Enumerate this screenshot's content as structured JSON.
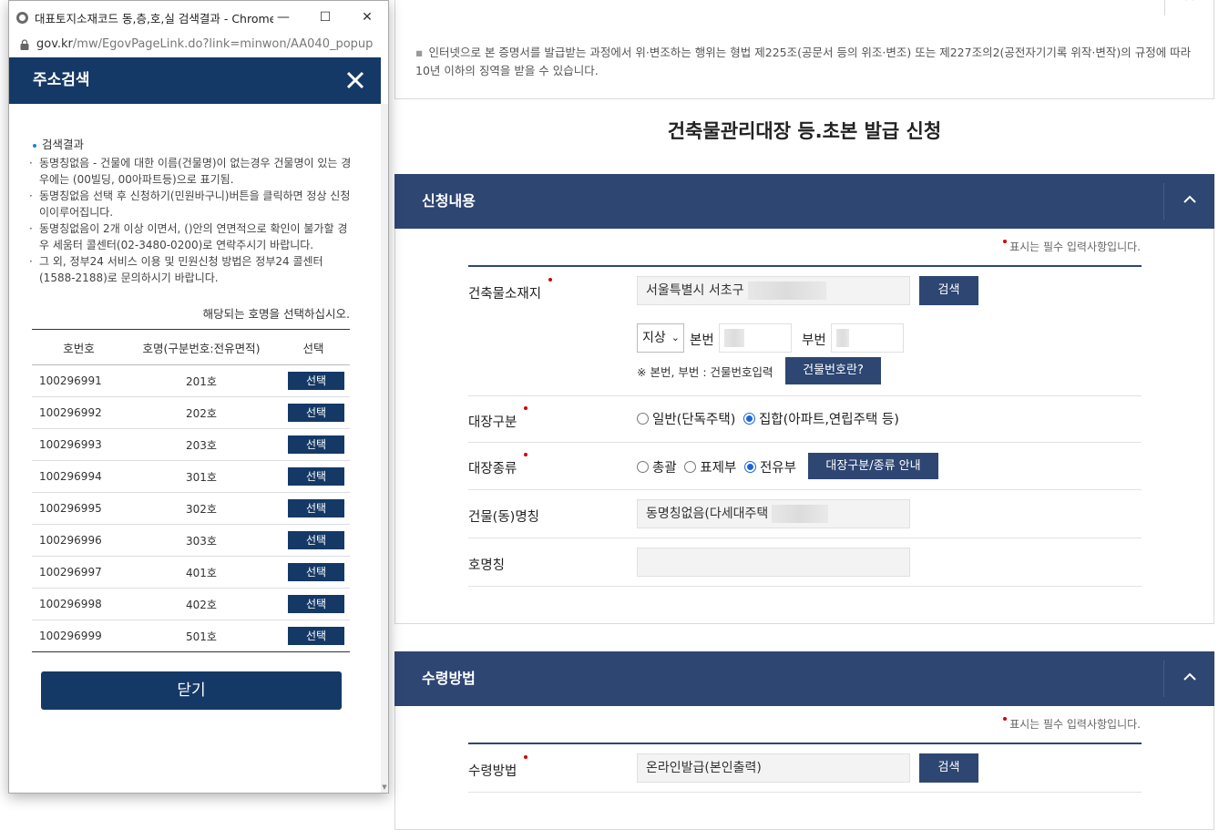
{
  "popup": {
    "window_title": "대표토지소재코드 동,층,호,실 검색결과 - Chrome",
    "url_host": "gov.kr",
    "url_path": "/mw/EgovPageLink.do?link=minwon/AA040_popup",
    "header_title": "주소검색",
    "result_heading": "검색결과",
    "guide": [
      "동명칭없음 - 건물에 대한 이름(건물명)이 없는경우 건물명이 있는 경우에는 (00빌딩, 00아파트등)으로 표기됨.",
      "동명칭없음 선택 후 신청하기(민원바구니)버튼을 클릭하면 정상 신청이이루어집니다.",
      "동명칭없음이 2개 이상 이면서, ()안의 연면적으로 확인이 불가할 경우 세움터 콜센터(02-3480-0200)로 연락주시기 바랍니다.",
      "그 외, 정부24 서비스 이용 및 민원신청 방법은 정부24 콜센터 (1588-2188)로 문의하시기 바랍니다."
    ],
    "select_message": "해당되는 호명을 선택하십시오.",
    "table": {
      "headers": [
        "호번호",
        "호명(구분번호:전유면적)",
        "선택"
      ],
      "rows": [
        {
          "no": "100296991",
          "name": "201호",
          "action": "선택"
        },
        {
          "no": "100296992",
          "name": "202호",
          "action": "선택"
        },
        {
          "no": "100296993",
          "name": "203호",
          "action": "선택"
        },
        {
          "no": "100296994",
          "name": "301호",
          "action": "선택"
        },
        {
          "no": "100296995",
          "name": "302호",
          "action": "선택"
        },
        {
          "no": "100296996",
          "name": "303호",
          "action": "선택"
        },
        {
          "no": "100296997",
          "name": "401호",
          "action": "선택"
        },
        {
          "no": "100296998",
          "name": "402호",
          "action": "선택"
        },
        {
          "no": "100296999",
          "name": "501호",
          "action": "선택"
        }
      ]
    },
    "close_label": "닫기"
  },
  "notice": {
    "text": "인터넷으로 본 증명서를 발급받는 과정에서 위·변조하는 행위는 형법 제225조(공문서 등의 위조·변조) 또는 제227조의2(공전자기기록 위작·변작)의 규정에 따라 10년 이하의 징역을 받을 수 있습니다."
  },
  "page_title": "건축물관리대장 등.초본 발급 신청",
  "section1": {
    "title": "신청내용",
    "required_note": "표시는 필수 입력사항입니다.",
    "location_label": "건축물소재지",
    "location_value": "서울특별시 서초구",
    "search_label": "검색",
    "land_type": "지상",
    "main_no_label": "본번",
    "sub_no_label": "부번",
    "hint": "※ 본번, 부번 : 건물번호입력",
    "building_no_button": "건물번호란?",
    "ledger_type_label": "대장구분",
    "ledger_type_options": [
      "일반(단독주택)",
      "집합(아파트,연립주택 등)"
    ],
    "ledger_kind_label": "대장종류",
    "ledger_kind_options": [
      "총괄",
      "표제부",
      "전유부"
    ],
    "ledger_guide_button": "대장구분/종류 안내",
    "building_name_label": "건물(동)명칭",
    "building_name_value": "동명칭없음(다세대주택",
    "unit_name_label": "호명칭",
    "unit_name_value": ""
  },
  "section2": {
    "title": "수령방법",
    "required_note": "표시는 필수 입력사항입니다.",
    "method_label": "수령방법",
    "method_value": "온라인발급(본인출력)",
    "search_label": "검색"
  }
}
